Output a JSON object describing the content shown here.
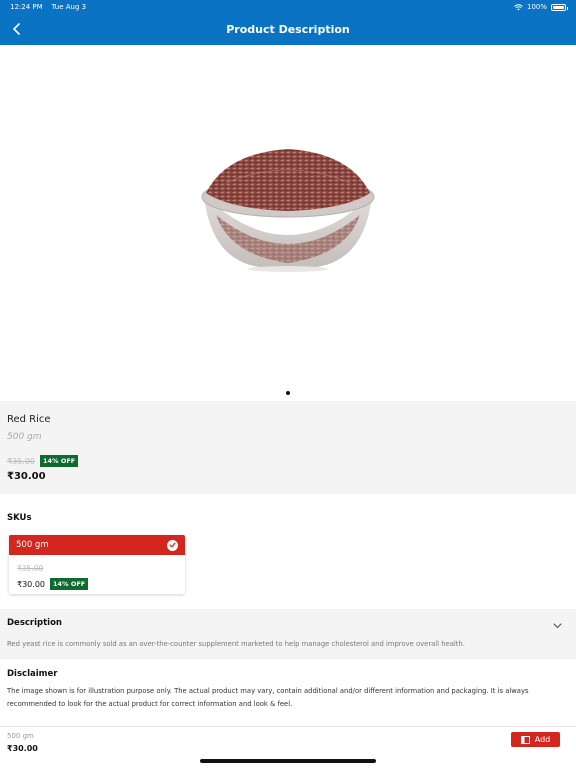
{
  "status_bar": {
    "time": "12:24 PM",
    "date": "Tue Aug 3",
    "battery": "100%",
    "battery_level": 1.0
  },
  "header": {
    "title": "Product Description",
    "back_icon": "chevron-left-icon"
  },
  "carousel": {
    "image": "red-rice-bowl",
    "page_count": 1,
    "current_page": 1
  },
  "product": {
    "name": "Red Rice",
    "weight": "500 gm",
    "mrp": "₹35.00",
    "discount": "14% OFF",
    "price": "₹30.00"
  },
  "skus": {
    "title": "SKUs",
    "items": [
      {
        "label": "500 gm",
        "mrp": "₹35.00",
        "price": "₹30.00",
        "discount": "14% OFF",
        "selected": true
      }
    ]
  },
  "description": {
    "title": "Description",
    "text": "Red yeast rice is commonly sold as an over-the-counter supplement marketed to help manage cholesterol and improve overall health."
  },
  "disclaimer": {
    "title": "Disclaimer",
    "text": "The image shown is for illustration purpose only. The actual product may vary, contain additional and/or different information and packaging. It is always recommended to look for the actual product for correct information and look & feel."
  },
  "bottom_bar": {
    "weight": "500 gm",
    "price": "₹30.00",
    "add_label": "Add"
  },
  "colors": {
    "header_blue": "#0a73c4",
    "accent_red": "#d3261f",
    "discount_green": "#0e6b2e"
  }
}
